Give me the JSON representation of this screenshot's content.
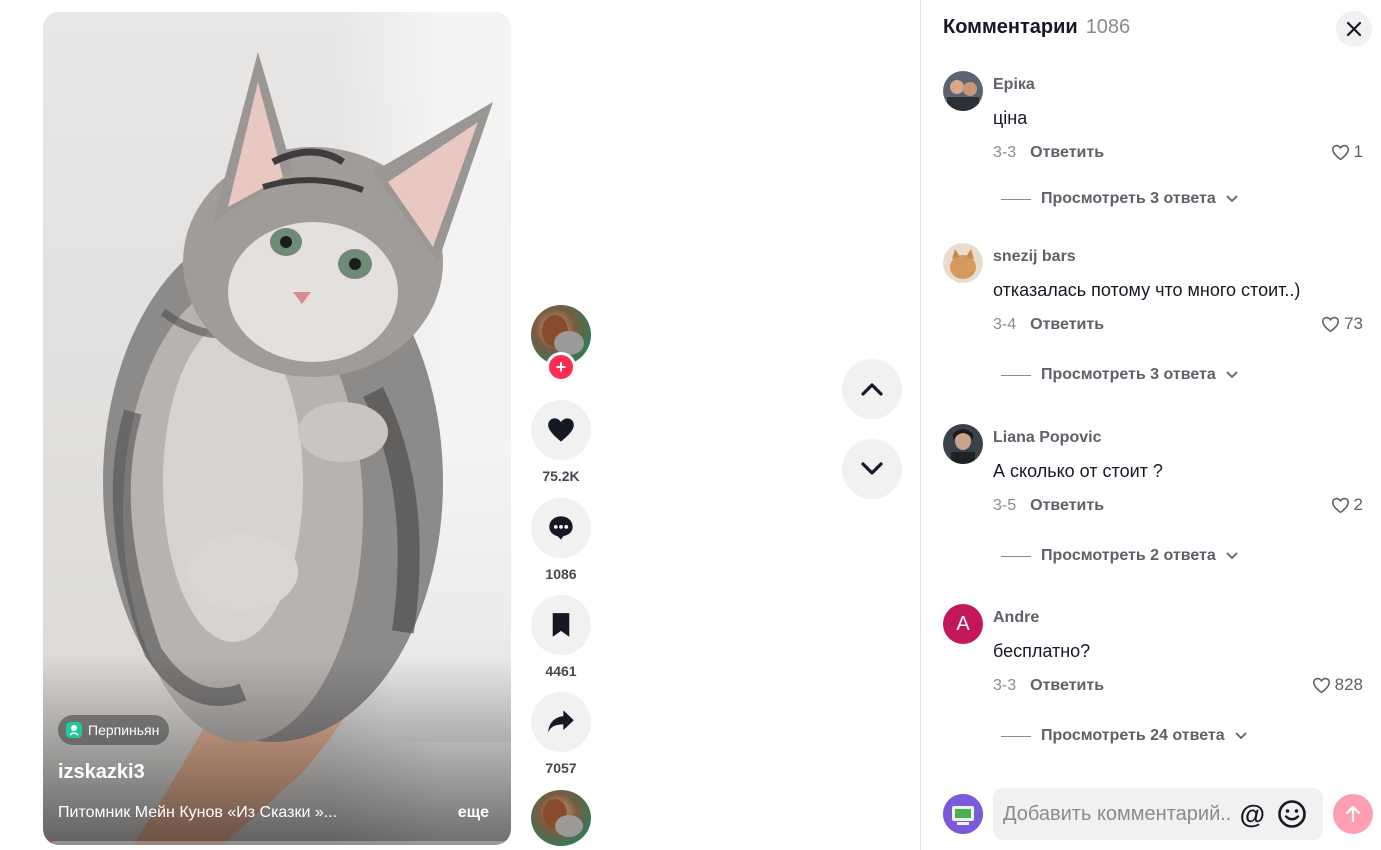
{
  "video": {
    "location": "Перпиньян",
    "username": "izskazki3",
    "caption": "Питомник Мейн Кунов «Из Сказки »...",
    "more_label": "еще",
    "progress_percent": 2
  },
  "actions": {
    "likes": "75.2K",
    "comments": "1086",
    "saves": "4461",
    "shares": "7057",
    "follow_label": "+"
  },
  "comments_panel": {
    "title": "Комментарии",
    "count": "1086",
    "items": [
      {
        "name": "Еріка",
        "text": "ціна",
        "date": "3-3",
        "reply_label": "Ответить",
        "likes": "1",
        "replies_label": "Просмотреть 3 ответа"
      },
      {
        "name": "snezij bars",
        "text": "отказалась потому что много стоит..)",
        "date": "3-4",
        "reply_label": "Ответить",
        "likes": "73",
        "replies_label": "Просмотреть 3 ответа"
      },
      {
        "name": "Liana Popovic",
        "text": "А сколько от стоит ?",
        "date": "3-5",
        "reply_label": "Ответить",
        "likes": "2",
        "replies_label": "Просмотреть 2 ответа"
      },
      {
        "name": "Andre",
        "avatar_letter": "A",
        "text": "бесплатно?",
        "date": "3-3",
        "reply_label": "Ответить",
        "likes": "828",
        "replies_label": "Просмотреть 24 ответа"
      }
    ],
    "input": {
      "placeholder": "Добавить комментарий...",
      "at_symbol": "@"
    }
  },
  "colors": {
    "accent": "#fe2c55",
    "muted": "#8a8b91",
    "text": "#161823",
    "location_badge": "#20c997",
    "andre_avatar": "#c2185b"
  },
  "icons": [
    "location-icon",
    "heart-icon",
    "comment-icon",
    "bookmark-icon",
    "share-icon",
    "chevron-up-icon",
    "chevron-down-icon",
    "close-icon",
    "heart-outline-icon",
    "emoji-icon",
    "send-arrow-icon"
  ]
}
